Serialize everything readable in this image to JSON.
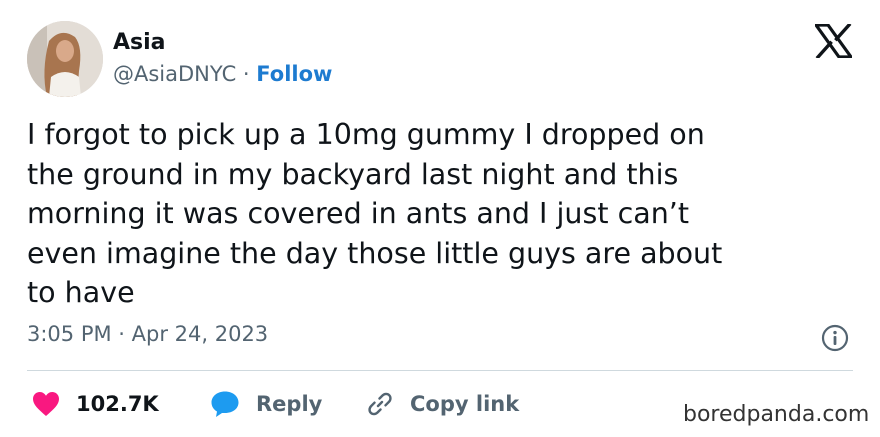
{
  "author": {
    "name": "Asia",
    "handle": "@AsiaDNYC",
    "separator": "·",
    "follow_label": "Follow"
  },
  "tweet": {
    "text": "I forgot to pick up a 10mg gummy I dropped on\nthe ground in my backyard last night and this\nmorning it was covered in ants and I just can’t\neven imagine the day those little guys are about\nto have",
    "timestamp": "3:05 PM · Apr 24, 2023"
  },
  "actions": {
    "likes_count": "102.7K",
    "reply_label": "Reply",
    "copy_link_label": "Copy link"
  },
  "icons": {
    "brand": "x-logo-icon",
    "info": "info-icon",
    "like": "heart-icon",
    "reply": "speech-bubble-icon",
    "copy_link": "link-icon"
  },
  "colors": {
    "follow": "#1d7bd0",
    "heart": "#f91880",
    "reply_bubble": "#1d9bf0",
    "secondary_text": "#536471"
  },
  "watermark": "boredpanda.com"
}
